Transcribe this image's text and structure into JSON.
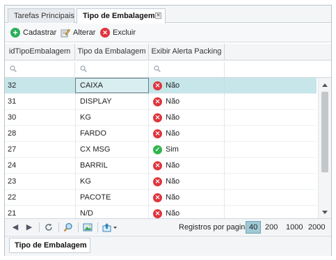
{
  "tabs": [
    {
      "label": "Tarefas Principais"
    },
    {
      "label": "Tipo de Embalagem"
    }
  ],
  "toolbar": {
    "add_label": "Cadastrar",
    "edit_label": "Alterar",
    "delete_label": "Excluir"
  },
  "columns": [
    "idTipoEmbalagem",
    "Tipo da Embalagem",
    "Exibir Alerta Packing"
  ],
  "rows": [
    {
      "id": "32",
      "tipo": "CAIXA",
      "alerta": "Não",
      "flag": "no"
    },
    {
      "id": "31",
      "tipo": "DISPLAY",
      "alerta": "Não",
      "flag": "no"
    },
    {
      "id": "30",
      "tipo": "KG",
      "alerta": "Não",
      "flag": "no"
    },
    {
      "id": "28",
      "tipo": "FARDO",
      "alerta": "Não",
      "flag": "no"
    },
    {
      "id": "27",
      "tipo": "CX MSG",
      "alerta": "Sim",
      "flag": "yes"
    },
    {
      "id": "24",
      "tipo": "BARRIL",
      "alerta": "Não",
      "flag": "no"
    },
    {
      "id": "23",
      "tipo": "KG",
      "alerta": "Não",
      "flag": "no"
    },
    {
      "id": "22",
      "tipo": "PACOTE",
      "alerta": "Não",
      "flag": "no"
    },
    {
      "id": "21",
      "tipo": "N/D",
      "alerta": "Não",
      "flag": "no"
    }
  ],
  "pager": {
    "label": "Registros por pagina:",
    "sizes": [
      "40",
      "200",
      "1000",
      "2000"
    ],
    "active_size": "40"
  },
  "bottom_tab": {
    "label": "Tipo de Embalagem"
  },
  "colors": {
    "selected_row": "#c6e6ea",
    "no_flag": "#e0343d",
    "yes_flag": "#33b54c",
    "add": "#2bb05c"
  }
}
